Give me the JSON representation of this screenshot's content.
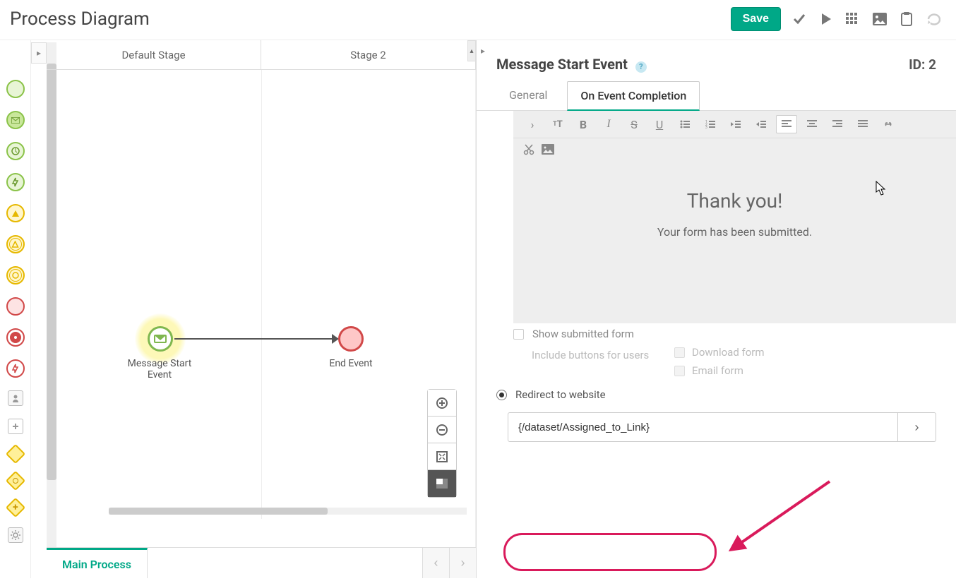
{
  "header": {
    "title": "Process Diagram",
    "save_label": "Save"
  },
  "stages": {
    "col1": "Default Stage",
    "col2": "Stage 2"
  },
  "diagram": {
    "start_label": "Message Start Event",
    "end_label": "End Event"
  },
  "footer": {
    "tab": "Main Process"
  },
  "props": {
    "title": "Message Start Event",
    "id_label": "ID: 2",
    "tabs": {
      "general": "General",
      "completion": "On Event Completion"
    },
    "editor": {
      "heading": "Thank you!",
      "body": "Your form has been submitted."
    },
    "show_submitted": "Show submitted form",
    "include_buttons": "Include buttons for users",
    "download_form": "Download form",
    "email_form": "Email form",
    "redirect_label": "Redirect to website",
    "redirect_value": "{/dataset/Assigned_to_Link}"
  }
}
